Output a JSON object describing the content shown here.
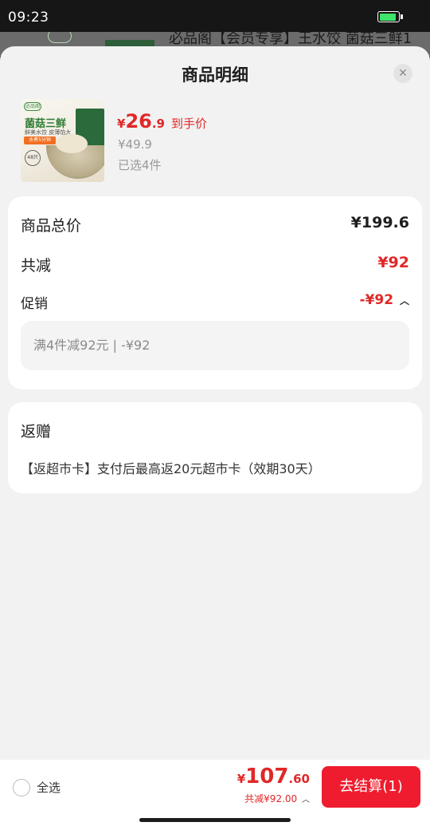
{
  "status_bar": {
    "time": "09:23",
    "battery_level": 0.9,
    "battery_color": "#3ee36a"
  },
  "background_page": {
    "title_partial": "必品阁【会员专享】王水饺 菌菇三鲜1"
  },
  "sheet": {
    "title": "商品明细",
    "close_icon": "close-icon"
  },
  "product": {
    "image_text": {
      "logo": "必品阁",
      "title": "菌菇三鲜",
      "subtitle": "鲜美水饺 皮薄馅大",
      "tag": "水煮5分钟",
      "count": "48只"
    },
    "price_yen": "¥",
    "price_integer": "26",
    "price_decimal": ".9",
    "price_label": "到手价",
    "original_price": "¥49.9",
    "selected": "已选4件"
  },
  "price_card": {
    "total_label": "商品总价",
    "total_value": "¥199.6",
    "reduce_label": "共减",
    "reduce_value": "¥92",
    "promo_label": "促销",
    "promo_value": "-¥92",
    "promo_toggle_icon": "chevron-up-icon",
    "promo_detail": "满4件减92元 | -¥92"
  },
  "gift_card": {
    "title": "返赠",
    "text": "【返超市卡】支付后最高返20元超市卡（效期30天）"
  },
  "bottom_bar": {
    "select_all": "全选",
    "total_yen": "¥",
    "total_integer": "107",
    "total_decimal": ".60",
    "discount_text": "共减¥92.00",
    "discount_toggle_icon": "chevron-up-icon",
    "checkout_label": "去结算(1)"
  },
  "colors": {
    "accent": "#e02828",
    "checkout": "#ee1c2e"
  }
}
